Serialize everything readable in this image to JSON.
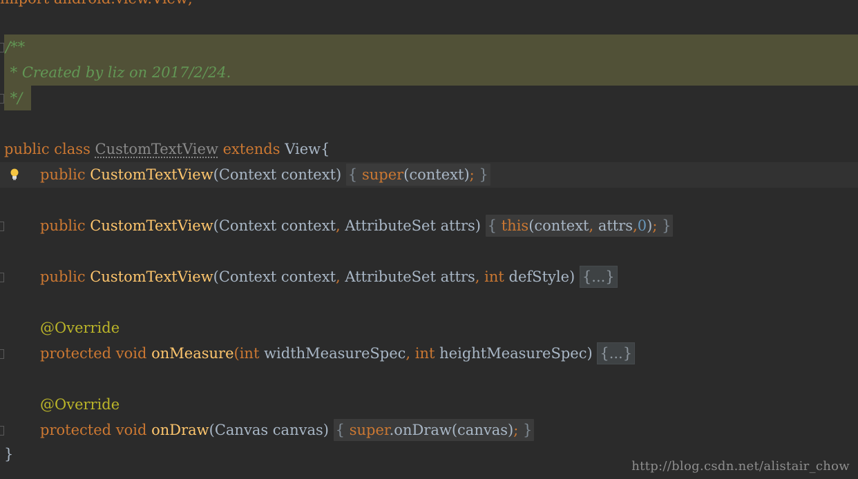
{
  "editor": {
    "top_partial_line": "import android.view.View;",
    "doc_comment": {
      "open": "/**",
      "body": " * Created by liz on 2017/2/24.",
      "close": " */"
    },
    "class_decl": {
      "kw_public": "public",
      "kw_class": "class",
      "class_name": "CustomTextView",
      "kw_extends": "extends",
      "super_type": "View{"
    },
    "ctor1": {
      "kw_public": "public",
      "name": "CustomTextView",
      "params_open": "(Context context)",
      "body_open": "{",
      "kw_super": "super",
      "call": "(context)",
      "semi": ";",
      "body_close": "}"
    },
    "ctor2": {
      "kw_public": "public",
      "name": "CustomTextView",
      "p1": "(Context context",
      "comma1": ",",
      "p2": " AttributeSet attrs)",
      "body_open": "{",
      "kw_this": "this",
      "call_a": "(context",
      "comma2": ",",
      "call_b": " attrs",
      "comma3": ",",
      "zero": "0",
      "call_c": ")",
      "semi": ";",
      "body_close": "}"
    },
    "ctor3": {
      "kw_public": "public",
      "name": "CustomTextView",
      "p1": "(Context context",
      "comma1": ",",
      "p2": " AttributeSet attrs",
      "comma2": ",",
      "kw_int": "int",
      "p3": " defStyle)",
      "folded": "{...}"
    },
    "annotation1": "@Override",
    "measure": {
      "kw_protected": "protected",
      "kw_void": "void",
      "name": "onMeasure",
      "paren_open": "(",
      "kw_int1": "int",
      "p1": " widthMeasureSpec",
      "comma": ",",
      "kw_int2": "int",
      "p2": " heightMeasureSpec)",
      "folded": "{...}"
    },
    "annotation2": "@Override",
    "draw": {
      "kw_protected": "protected",
      "kw_void": "void",
      "name": "onDraw",
      "params": "(Canvas canvas)",
      "body_open": "{",
      "kw_super": "super",
      "call": ".onDraw(canvas)",
      "semi": ";",
      "body_close": "}"
    },
    "class_close": "}"
  },
  "watermark": "http://blog.csdn.net/alistair_chow",
  "colors": {
    "background": "#2b2b2b",
    "keyword": "#cc7832",
    "method": "#ffc66d",
    "number": "#6897bb",
    "annotation": "#bbb529",
    "comment": "#629755",
    "doc_highlight": "#515137"
  }
}
